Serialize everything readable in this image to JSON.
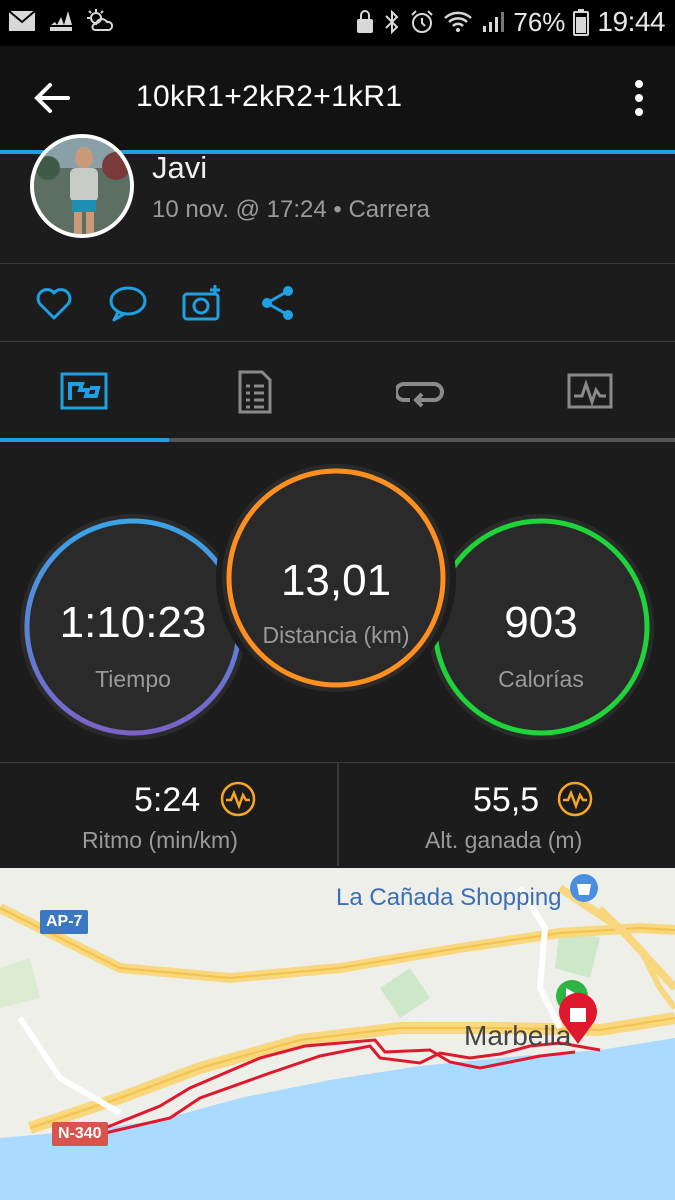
{
  "status_bar": {
    "battery_pct": "76%",
    "time": "19:44",
    "left_icons": [
      "mail-icon",
      "adidas-icon",
      "weather-icon"
    ],
    "right_icons": [
      "lock-icon",
      "bluetooth-icon",
      "alarm-icon",
      "wifi-icon",
      "signal-icon",
      "battery-icon"
    ]
  },
  "app_bar": {
    "title": "10kR1+2kR2+1kR1",
    "back_icon": "arrow-left-icon",
    "menu_icon": "more-vert-icon"
  },
  "profile": {
    "name": "Javi",
    "meta": "10 nov. @ 17:24 • Carrera"
  },
  "actions": [
    "like-icon",
    "comment-icon",
    "add-photo-icon",
    "share-icon"
  ],
  "tabs": [
    {
      "icon": "overview-icon",
      "active": true
    },
    {
      "icon": "details-icon",
      "active": false
    },
    {
      "icon": "laps-icon",
      "active": false
    },
    {
      "icon": "charts-icon",
      "active": false
    }
  ],
  "stats": {
    "time": {
      "value": "1:10:23",
      "label": "Tiempo"
    },
    "distance": {
      "value": "13,01",
      "label": "Distancia (km)"
    },
    "calories": {
      "value": "903",
      "label": "Calorías"
    }
  },
  "metrics": {
    "pace": {
      "value": "5:24",
      "label": "Ritmo (min/km)"
    },
    "ascent": {
      "value": "55,5",
      "label": "Alt. ganada (m)"
    }
  },
  "map": {
    "poi": "La Cañada Shopping",
    "city": "Marbella",
    "road_ap7": "AP-7",
    "road_n340": "N-340"
  },
  "colors": {
    "accent": "#1fa0e2",
    "distance_ring": "#ff8f1f",
    "calories_ring": "#1fd33a",
    "route": "#e0182d",
    "metric_icon": "#f5a623"
  }
}
